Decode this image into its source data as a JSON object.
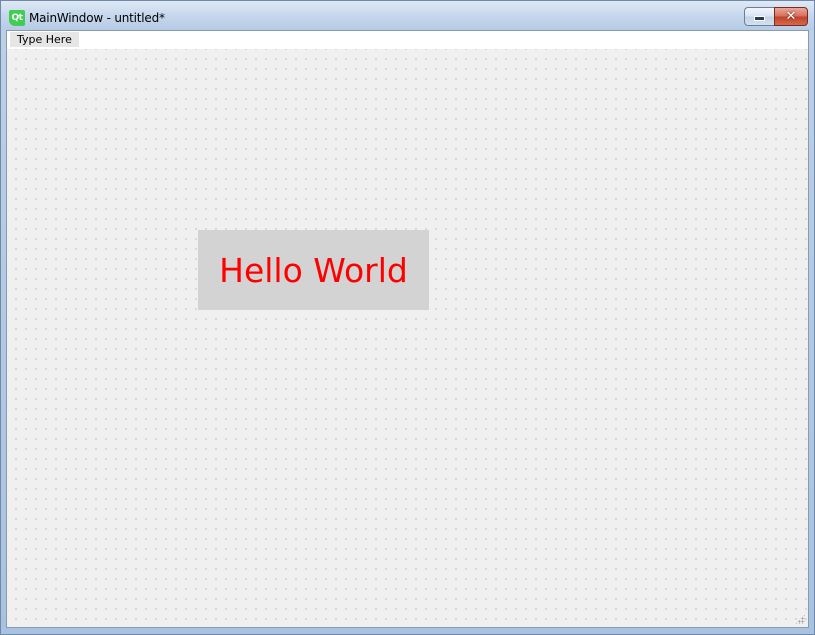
{
  "window": {
    "title": "MainWindow - untitled*",
    "app_icon_text": "Qt",
    "caption_buttons": {
      "minimize_icon": "minimize-icon",
      "close_icon": "close-icon",
      "close_glyph": "✕"
    }
  },
  "menubar": {
    "placeholder_item": "Type Here"
  },
  "form": {
    "label_text": "Hello World",
    "label_text_color": "#ff0000",
    "label_background": "#d3d3d3"
  }
}
